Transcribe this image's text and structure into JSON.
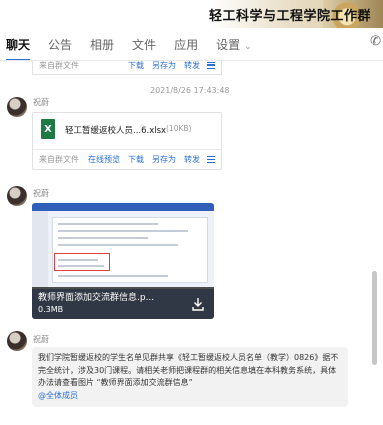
{
  "header": {
    "title": "轻工科学与工程学院工作群"
  },
  "tabs": [
    {
      "label": "聊天",
      "active": true
    },
    {
      "label": "公告"
    },
    {
      "label": "相册"
    },
    {
      "label": "文件"
    },
    {
      "label": "应用"
    },
    {
      "label": "设置"
    }
  ],
  "messages": {
    "prev_file": {
      "source": "来自群文件",
      "actions": [
        "下载",
        "另存为",
        "转发"
      ]
    },
    "timestamp": "2021/8/26 17:43:48",
    "msg1": {
      "sender": "祝蔚",
      "file_name": "轻工暂缓返校人员...6.xlsx",
      "file_size": "(10KB)",
      "source": "来自群文件",
      "actions": [
        "在线预览",
        "下载",
        "另存为",
        "转发"
      ]
    },
    "msg2": {
      "sender": "祝蔚",
      "image_name": "教师界面添加交流群信息.p...",
      "image_size": "0.3MB"
    },
    "msg3": {
      "sender": "祝蔚",
      "text": "我们学院暂缓返校的学生名单见群共享《轻工暂缓返校人员名单（教学）0826》据不完全统计，涉及30门课程。请相关老师把课程群的相关信息填在本科教务系统，具体办法请查看图片 “教师界面添加交流群信息”",
      "mention": "@全体成员"
    }
  },
  "colors": {
    "accent": "#2b6fd6",
    "excel_green": "#1d7a45"
  },
  "icons": [
    "excel-icon",
    "download-icon",
    "menu-icon",
    "phone-icon",
    "chevron-down-icon"
  ]
}
